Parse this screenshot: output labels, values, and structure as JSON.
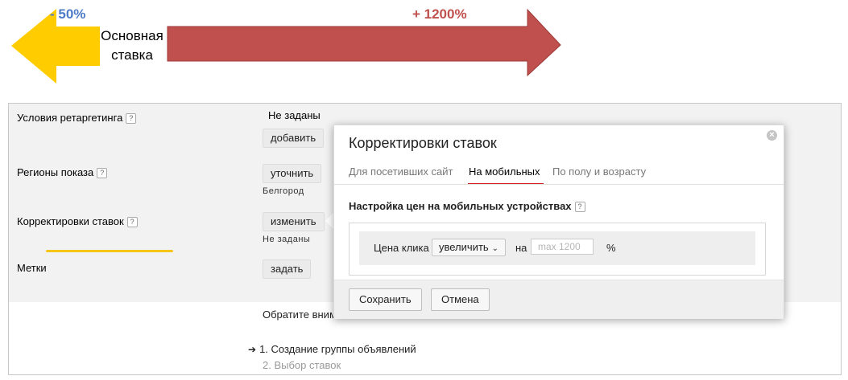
{
  "annotations": {
    "minus": "- 50%",
    "plus": "+ 1200%",
    "base_line1": "Основная",
    "base_line2": "ставка",
    "colors": {
      "minus_text": "#4e7ac7",
      "plus_text": "#c0504d",
      "left_arrow": "#ffcc00",
      "right_arrow": "#c0504d",
      "highlight_line": "#f5c518"
    }
  },
  "settings": {
    "retargeting": {
      "label": "Условия ретаргетинга",
      "value": "Не заданы",
      "button": "добавить"
    },
    "regions": {
      "label": "Регионы показа",
      "button": "уточнить",
      "value": "Белгород"
    },
    "bid_adjust": {
      "label": "Корректировки ставок",
      "button": "изменить",
      "value": "Не заданы"
    },
    "tags": {
      "label": "Метки",
      "button": "задать"
    },
    "help_icon": "?"
  },
  "popup": {
    "title": "Корректировки ставок",
    "close": "×",
    "tabs": [
      {
        "label": "Для посетивших сайт",
        "active": false
      },
      {
        "label": "На мобильных",
        "active": true
      },
      {
        "label": "По полу и возрасту",
        "active": false
      }
    ],
    "section_title": "Настройка цен на мобильных устройствах",
    "price_label": "Цена клика",
    "select_value": "увеличить",
    "na": "на",
    "input_placeholder": "max 1200",
    "input_value": "",
    "percent": "%",
    "save_button": "Сохранить",
    "cancel_button": "Отмена",
    "accent_color": "#d61d1d"
  },
  "below": {
    "note": "Обратите вним",
    "steps": [
      {
        "arrow": "➔",
        "label": "1. Создание группы объявлений"
      },
      {
        "label": "2. Выбор ставок"
      }
    ]
  }
}
